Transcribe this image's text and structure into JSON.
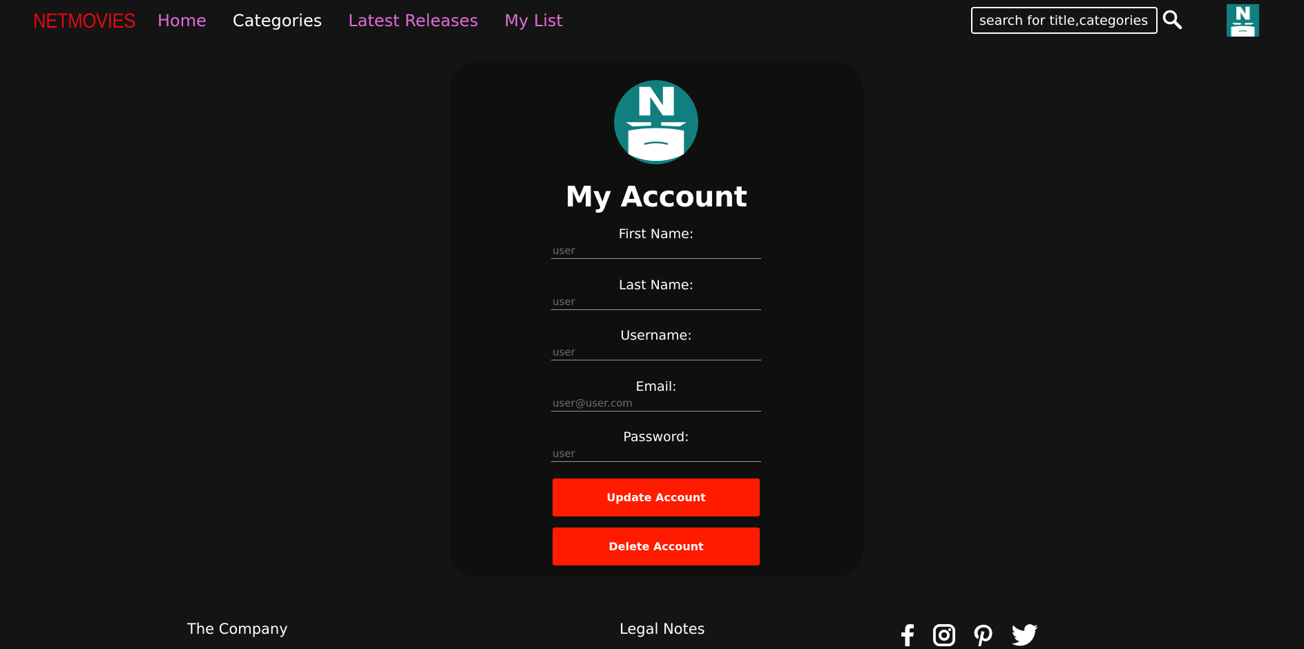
{
  "header": {
    "logo": "NETMOVIES",
    "nav": [
      "Home",
      "Categories",
      "Latest Releases",
      "My List"
    ],
    "active_nav": "Categories",
    "search_placeholder": "search for title,categories...",
    "search_icon": "search-icon",
    "avatar_icon": "masked-hero-avatar-icon"
  },
  "account": {
    "avatar_icon": "masked-hero-avatar-icon",
    "title": "My Account",
    "fields": [
      {
        "label": "First Name:",
        "placeholder": "user"
      },
      {
        "label": "Last Name:",
        "placeholder": "user"
      },
      {
        "label": "Username:",
        "placeholder": "user"
      },
      {
        "label": "Email:",
        "placeholder": "user@user.com"
      },
      {
        "label": "Password:",
        "placeholder": "user"
      }
    ],
    "update_button": "Update Account",
    "delete_button": "Delete Account"
  },
  "footer": {
    "company": "The Company",
    "legal": "Legal Notes",
    "social_icons": [
      "facebook-icon",
      "instagram-icon",
      "pinterest-icon",
      "twitter-icon"
    ]
  },
  "colors": {
    "background": "#141414",
    "card": "#0f0f0f",
    "logo": "#e50914",
    "nav_link": "#e26bd9",
    "button": "#ff1b00",
    "avatar_teal": "#117f80"
  }
}
